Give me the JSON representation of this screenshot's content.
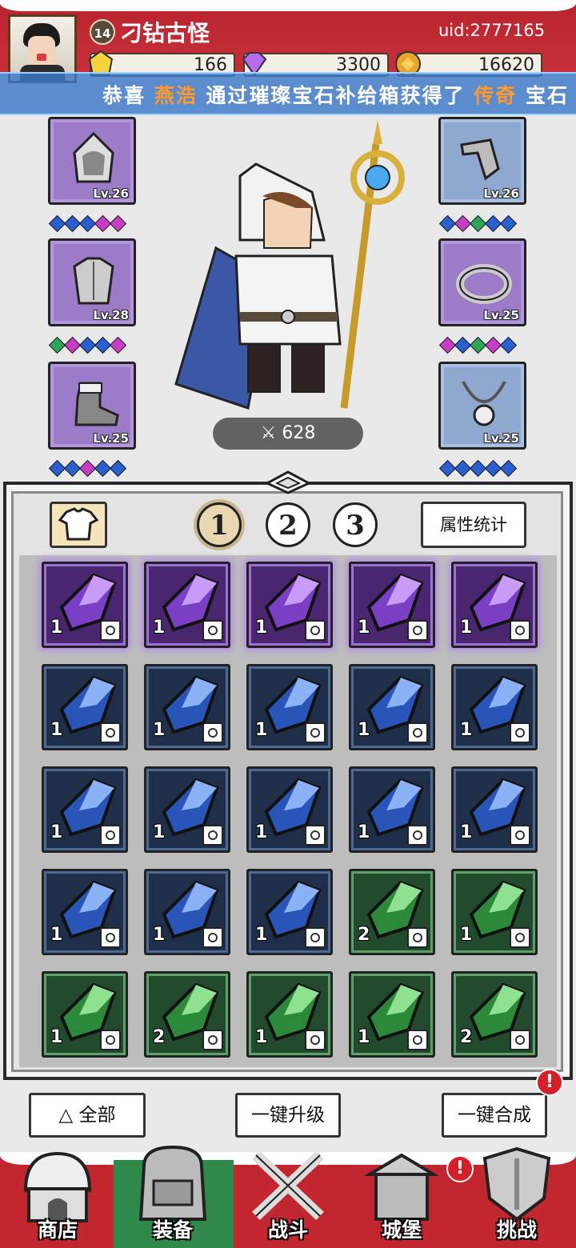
{
  "header": {
    "level": "14",
    "player_name": "刁钻古怪",
    "uid": "uid:2777165",
    "resources": [
      {
        "icon": "yellow-gem-icon",
        "value": "166"
      },
      {
        "icon": "purple-diamond-icon",
        "value": "3300"
      },
      {
        "icon": "gold-coin-icon",
        "value": "16620"
      }
    ]
  },
  "ticker": {
    "prefix": "恭喜",
    "player": "燕浩",
    "middle": "通过璀璨宝石补给箱获得了",
    "rarity": "传奇",
    "suffix": "宝石"
  },
  "equipment": {
    "left": [
      {
        "icon": "hood-icon",
        "level": "Lv.26",
        "gems": [
          "b",
          "b",
          "b",
          "p",
          "p"
        ],
        "color": "purple"
      },
      {
        "icon": "armor-icon",
        "level": "Lv.28",
        "gems": [
          "g",
          "p",
          "b",
          "b",
          "p"
        ],
        "color": "purple"
      },
      {
        "icon": "boots-icon",
        "level": "Lv.25",
        "gems": [
          "b",
          "b",
          "p",
          "b",
          "b"
        ],
        "color": "purple"
      }
    ],
    "right": [
      {
        "icon": "bracer-icon",
        "level": "Lv.26",
        "gems": [
          "b",
          "p",
          "g",
          "b",
          "b"
        ],
        "color": "blue"
      },
      {
        "icon": "ring-icon",
        "level": "Lv.25",
        "gems": [
          "p",
          "b",
          "g",
          "p",
          "b"
        ],
        "color": "purple"
      },
      {
        "icon": "necklace-icon",
        "level": "Lv.25",
        "gems": [
          "b",
          "b",
          "b",
          "b",
          "b"
        ],
        "color": "blue"
      }
    ],
    "power": "628"
  },
  "inventory": {
    "pages": [
      "1",
      "2",
      "3"
    ],
    "active_page": "1",
    "stats_button": "属性统计",
    "slots": [
      {
        "color": "purple",
        "count": "1"
      },
      {
        "color": "purple",
        "count": "1"
      },
      {
        "color": "purple",
        "count": "1"
      },
      {
        "color": "purple",
        "count": "1"
      },
      {
        "color": "purple",
        "count": "1"
      },
      {
        "color": "blue",
        "count": "1"
      },
      {
        "color": "blue",
        "count": "1"
      },
      {
        "color": "blue",
        "count": "1"
      },
      {
        "color": "blue",
        "count": "1"
      },
      {
        "color": "blue",
        "count": "1"
      },
      {
        "color": "blue",
        "count": "1"
      },
      {
        "color": "blue",
        "count": "1"
      },
      {
        "color": "blue",
        "count": "1"
      },
      {
        "color": "blue",
        "count": "1"
      },
      {
        "color": "blue",
        "count": "1"
      },
      {
        "color": "blue",
        "count": "1"
      },
      {
        "color": "blue",
        "count": "1"
      },
      {
        "color": "blue",
        "count": "1"
      },
      {
        "color": "green",
        "count": "2"
      },
      {
        "color": "green",
        "count": "1"
      },
      {
        "color": "green",
        "count": "1"
      },
      {
        "color": "green",
        "count": "2"
      },
      {
        "color": "green",
        "count": "1"
      },
      {
        "color": "green",
        "count": "1"
      },
      {
        "color": "green",
        "count": "2"
      }
    ]
  },
  "actions": {
    "filter_label": "全部",
    "upgrade_label": "一键升级",
    "merge_label": "一键合成",
    "notify_mark": "!"
  },
  "nav": [
    {
      "label": "商店",
      "icon": "shop-icon"
    },
    {
      "label": "装备",
      "icon": "backpack-icon"
    },
    {
      "label": "战斗",
      "icon": "crossed-swords-icon"
    },
    {
      "label": "城堡",
      "icon": "castle-icon"
    },
    {
      "label": "挑战",
      "icon": "shield-icon"
    }
  ],
  "colors": {
    "header_red": "#c6303a",
    "ticker_blue": "#3c78c8",
    "highlight_orange": "#ff9a2b",
    "nav_active_green": "#2f8a4a"
  }
}
